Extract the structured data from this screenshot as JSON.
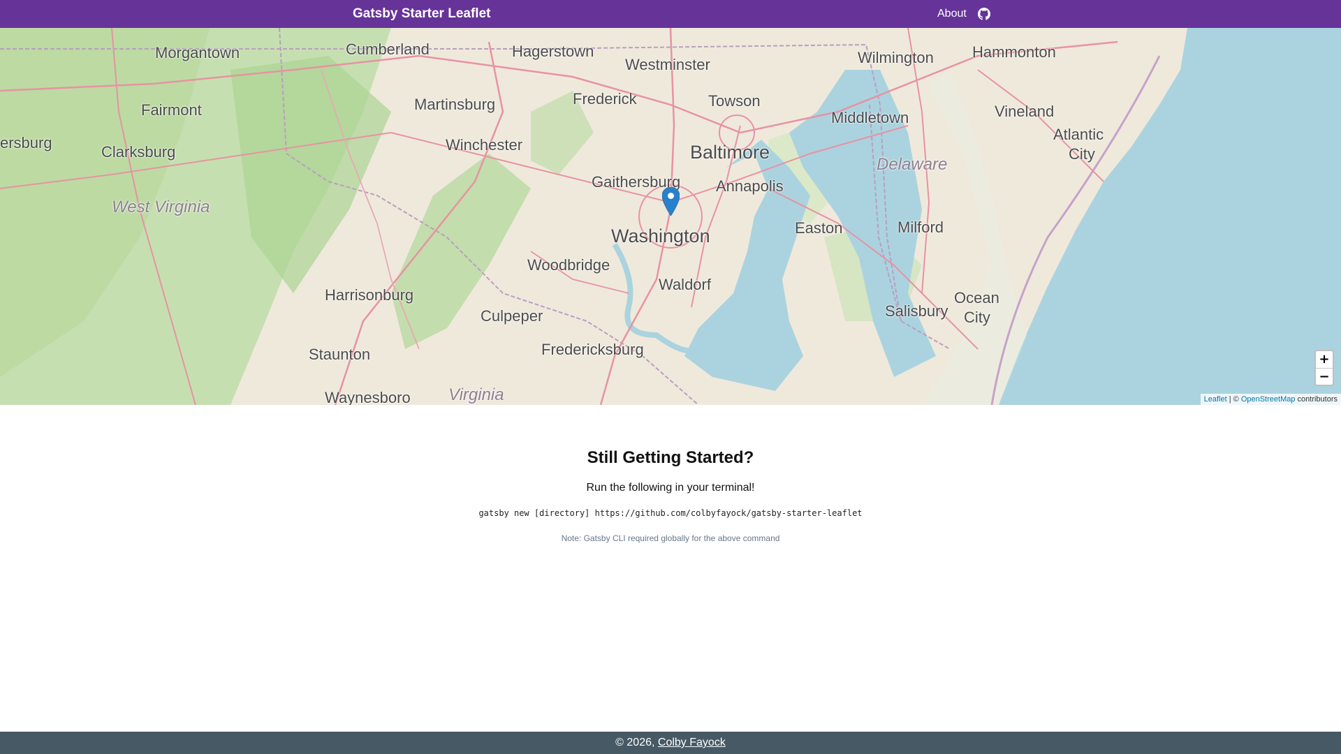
{
  "header": {
    "brand": "Gatsby Starter Leaflet",
    "nav": {
      "about_label": "About",
      "github_icon": "github-icon"
    },
    "color": "#663399"
  },
  "map": {
    "labels": {
      "morgantown": "Morgantown",
      "cumberland": "Cumberland",
      "hagerstown": "Hagerstown",
      "westminster": "Westminster",
      "wilmington": "Wilmington",
      "hammonton": "Hammonton",
      "fairmont": "Fairmont",
      "martinsburg": "Martinsburg",
      "frederick": "Frederick",
      "towson": "Towson",
      "vineland": "Vineland",
      "middletown": "Middletown",
      "atlantic": "Atlantic",
      "city1": "City",
      "clarksburg": "Clarksburg",
      "winchester": "Winchester",
      "baltimore": "Baltimore",
      "delaware": "Delaware",
      "gaithersburg": "Gaithersburg",
      "annapolis": "Annapolis",
      "westvirginia": "West Virginia",
      "washington": "Washington",
      "easton": "Easton",
      "milford": "Milford",
      "woodbridge": "Woodbridge",
      "waldorf": "Waldorf",
      "harrisonburg": "Harrisonburg",
      "culpeper": "Culpeper",
      "salisbury": "Salisbury",
      "ocean": "Ocean",
      "city2": "City",
      "fredericksburg": "Fredericksburg",
      "staunton": "Staunton",
      "waynesboro": "Waynesboro",
      "virginia": "Virginia",
      "ersburg": "ersburg"
    },
    "zoom_in": "+",
    "zoom_out": "−",
    "attribution": {
      "leaflet": "Leaflet",
      "sep": " | © ",
      "osm": "OpenStreetMap",
      "suffix": " contributors"
    }
  },
  "content": {
    "title": "Still Getting Started?",
    "subtitle": "Run the following in your terminal!",
    "command": "gatsby new [directory] https://github.com/colbyfayock/gatsby-starter-leaflet",
    "note": "Note: Gatsby CLI required globally for the above command"
  },
  "footer": {
    "prefix": "© 2026, ",
    "author": "Colby Fayock",
    "color": "#465965"
  }
}
